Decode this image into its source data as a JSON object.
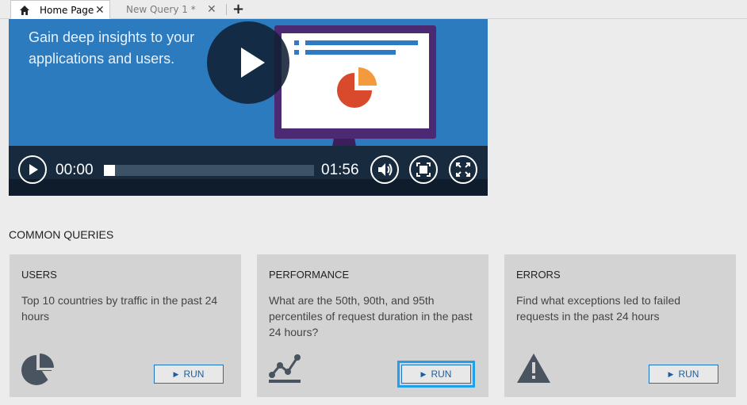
{
  "tabs": [
    {
      "label": "Home Page",
      "close": "✕",
      "active": true,
      "icon": "home-icon"
    },
    {
      "label": "New Query 1 *",
      "close": "✕",
      "active": false
    }
  ],
  "add_tab": "+",
  "video": {
    "headline": "Gain deep insights to your applications and users.",
    "current_time": "00:00",
    "duration": "01:56",
    "progress": 0,
    "icons": [
      "play-icon",
      "volume-icon",
      "fit-screen-icon",
      "fullscreen-icon"
    ]
  },
  "common_queries": {
    "title": "COMMON QUERIES",
    "cards": [
      {
        "title": "USERS",
        "description": "Top 10 countries by traffic in the past 24 hours",
        "run": "RUN",
        "icon": "pie-chart-icon"
      },
      {
        "title": "PERFORMANCE",
        "description": "What are the 50th, 90th, and 95th percentiles of request duration in the past 24 hours?",
        "run": "RUN",
        "icon": "line-chart-icon",
        "focused": true
      },
      {
        "title": "ERRORS",
        "description": "Find what exceptions led to failed requests in the past 24 hours",
        "run": "RUN",
        "icon": "warning-icon"
      }
    ]
  },
  "colors": {
    "video_bg": "#2c7bbf",
    "card_bg": "#d3d3d3",
    "run_border": "#1a73c0",
    "focus_ring": "#1ea0ea",
    "icon_dark": "#4a5460"
  }
}
